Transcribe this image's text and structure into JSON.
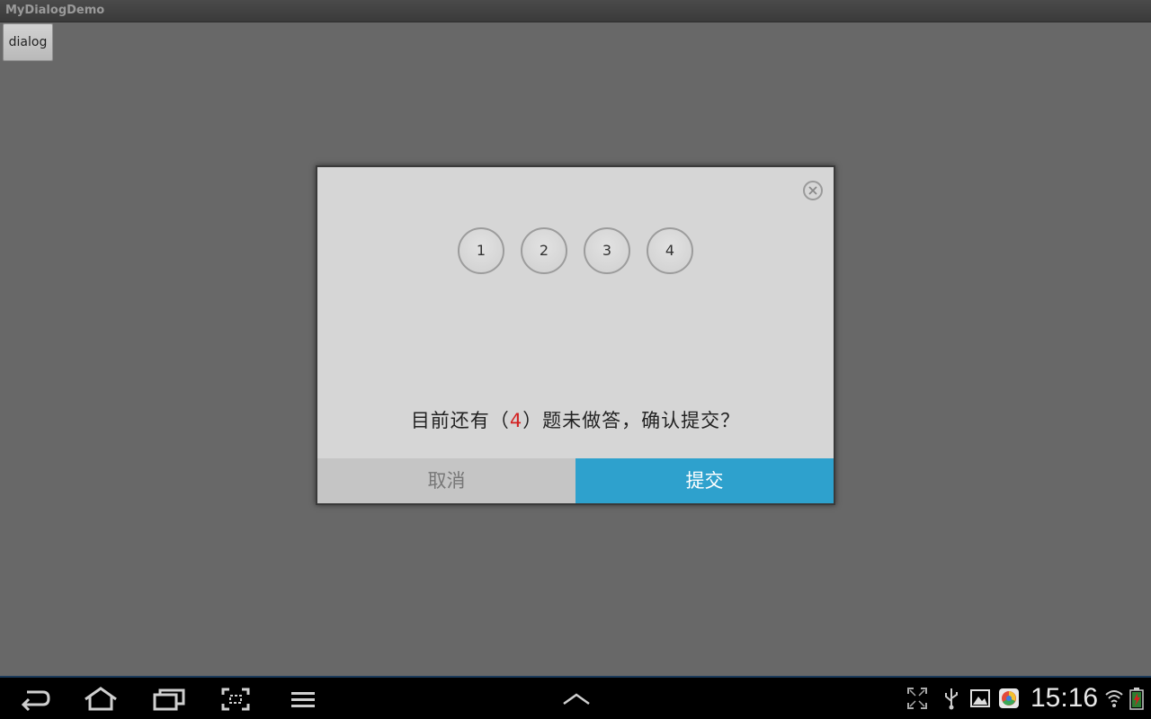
{
  "app": {
    "title": "MyDialogDemo"
  },
  "main": {
    "dialog_button_label": "dialog"
  },
  "dialog": {
    "questions": [
      "1",
      "2",
      "3",
      "4"
    ],
    "message_prefix": "目前还有（",
    "unanswered_count": "4",
    "message_suffix": "）题未做答，确认提交？",
    "cancel_label": "取消",
    "submit_label": "提交",
    "colors": {
      "submit": "#2ea1cd",
      "count": "#d32020"
    }
  },
  "statusbar": {
    "time": "15:16"
  },
  "icons": {
    "back": "back-icon",
    "home": "home-icon",
    "recents": "recents-icon",
    "screenshot": "screenshot-icon",
    "menu": "menu-icon",
    "up": "chevron-up-icon",
    "expand": "expand-icon",
    "usb": "usb-icon",
    "gallery": "gallery-icon",
    "app": "app-icon",
    "wifi": "wifi-icon",
    "battery": "battery-icon"
  }
}
